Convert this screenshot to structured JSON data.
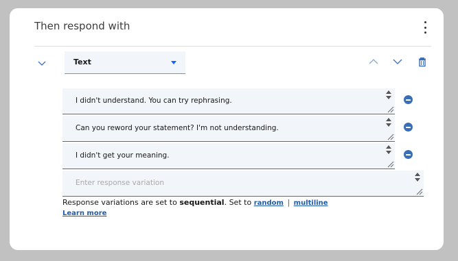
{
  "section": {
    "title": "Then respond with"
  },
  "response_type": {
    "selected": "Text"
  },
  "variations": [
    {
      "text": "I didn't understand. You can try rephrasing."
    },
    {
      "text": "Can you reword your statement? I'm not understanding."
    },
    {
      "text": "I didn't get your meaning."
    }
  ],
  "new_variation": {
    "placeholder": "Enter response variation"
  },
  "settings": {
    "prefix": "Response variations are set to",
    "mode": "sequential",
    "set_to": ". Set to",
    "option_random": "random",
    "separator": "|",
    "option_multiline": "multiline",
    "learn_more": "Learn more"
  },
  "colors": {
    "accent": "#0f62fe",
    "link": "#1f5aa8",
    "remove_icon": "#3a6fb7",
    "field_bg": "#f2f6fb"
  },
  "icons": [
    "kebab-menu-icon",
    "chevron-down-icon",
    "caret-down-icon",
    "chevron-up-icon",
    "trash-icon",
    "remove-circle-icon",
    "resize-handle-icon"
  ]
}
